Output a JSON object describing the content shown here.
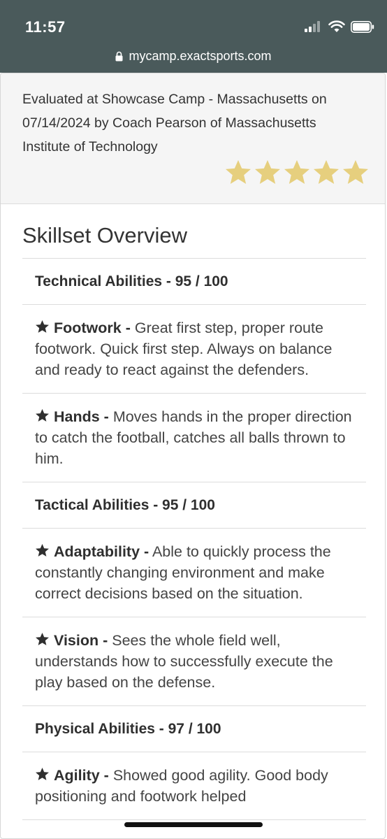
{
  "status_bar": {
    "time": "11:57"
  },
  "url_bar": {
    "url": "mycamp.exactsports.com"
  },
  "evaluation": {
    "text": "Evaluated at Showcase Camp - Massachusetts on 07/14/2024 by Coach Pearson of Massachusetts Institute of Technology",
    "rating": 5,
    "rating_max": 5,
    "star_color": "#e6cf7e"
  },
  "skillset": {
    "title": "Skillset Overview",
    "categories": [
      {
        "label": "Technical Abilities - 95 / 100",
        "skills": [
          {
            "name": "Footwork -",
            "text": " Great first step, proper route footwork. Quick first step. Always on balance and ready to react against the defenders."
          },
          {
            "name": "Hands -",
            "text": " Moves hands in the proper direction to catch the football, catches all balls thrown to him."
          }
        ]
      },
      {
        "label": "Tactical Abilities - 95 / 100",
        "skills": [
          {
            "name": "Adaptability -",
            "text": " Able to quickly process the constantly changing environment and make correct decisions based on the situation."
          },
          {
            "name": "Vision -",
            "text": " Sees the whole field well, understands how to successfully execute the play based on the defense."
          }
        ]
      },
      {
        "label": "Physical Abilities - 97 / 100",
        "skills": [
          {
            "name": "Agility -",
            "text": " Showed good agility. Good body positioning and footwork helped"
          }
        ]
      }
    ]
  }
}
